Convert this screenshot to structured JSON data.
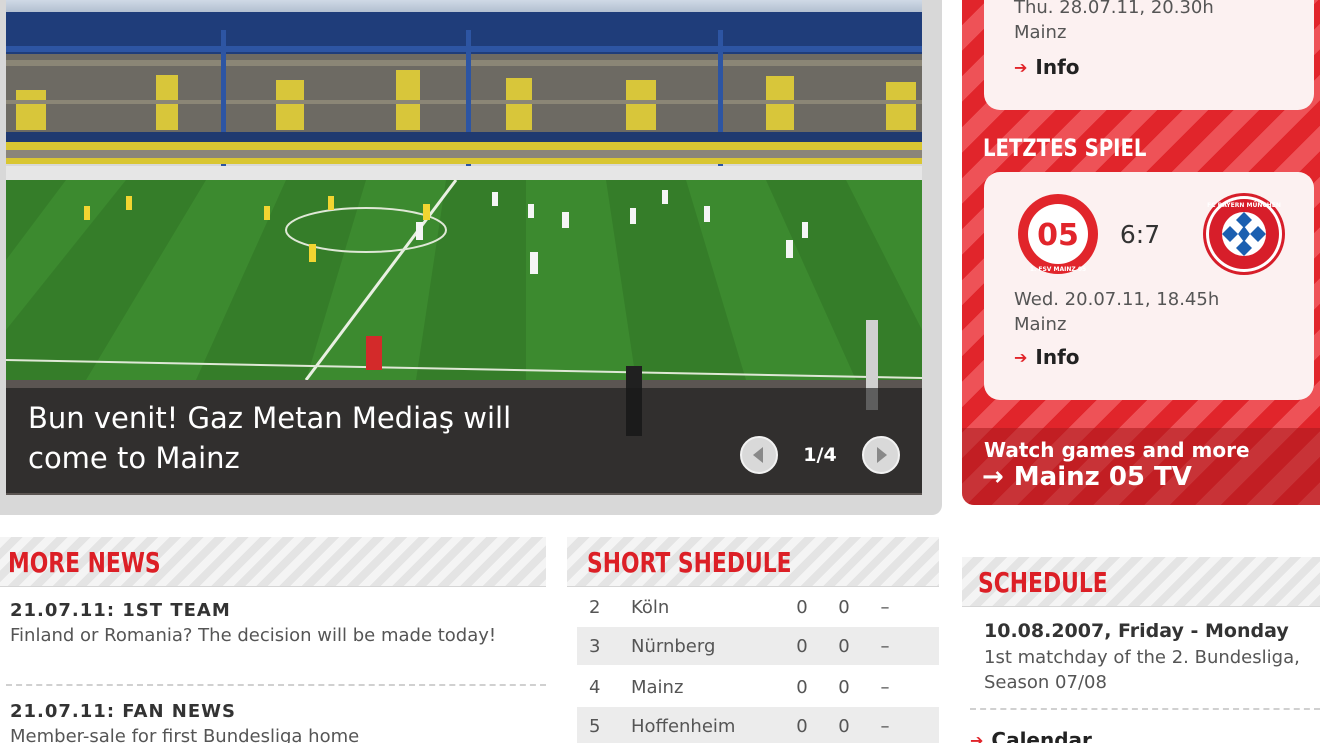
{
  "hero": {
    "title_line1": "Bun venit! Gaz Metan Mediaş will",
    "title_line2": "come to Mainz",
    "counter": "1/4"
  },
  "next_match": {
    "date": "Thu. 28.07.11, 20.30h",
    "venue": "Mainz",
    "info_label": "Info"
  },
  "last_match": {
    "heading": "LETZTES SPIEL",
    "home_crest_icon": "mainz-05-crest-icon",
    "away_crest_icon": "fc-bayern-crest-icon",
    "home_crest_text": "1. FSV MAINZ 05",
    "away_crest_text": "FC BAYERN MÜNCHEN",
    "score": "6:7",
    "date": "Wed. 20.07.11, 18.45h",
    "venue": "Mainz",
    "info_label": "Info"
  },
  "tv": {
    "line1": "Watch games and more",
    "line2": "Mainz 05 TV"
  },
  "more_news": {
    "heading": "MORE NEWS",
    "items": [
      {
        "head": "21.07.11: 1ST TEAM",
        "text": "Finland or Romania? The decision will be made today!"
      },
      {
        "head": "21.07.11: FAN NEWS",
        "text": "Member-sale for first Bundesliga home"
      }
    ]
  },
  "short_schedule": {
    "heading": "SHORT SHEDULE",
    "rows": [
      {
        "rank": "2",
        "team": "Köln",
        "a": "0",
        "b": "0",
        "c": "–"
      },
      {
        "rank": "3",
        "team": "Nürnberg",
        "a": "0",
        "b": "0",
        "c": "–"
      },
      {
        "rank": "4",
        "team": "Mainz",
        "a": "0",
        "b": "0",
        "c": "–"
      },
      {
        "rank": "5",
        "team": "Hoffenheim",
        "a": "0",
        "b": "0",
        "c": "–"
      }
    ]
  },
  "schedule": {
    "heading": "SCHEDULE",
    "date_bold": "10.08.2007, Friday",
    "date_rest": " - Monday",
    "text": "1st matchday of the 2. Bundesliga, Season 07/08",
    "link_label": "Calendar"
  },
  "colors": {
    "brand_red": "#e1252b",
    "card_bg": "#fcf1f1"
  }
}
